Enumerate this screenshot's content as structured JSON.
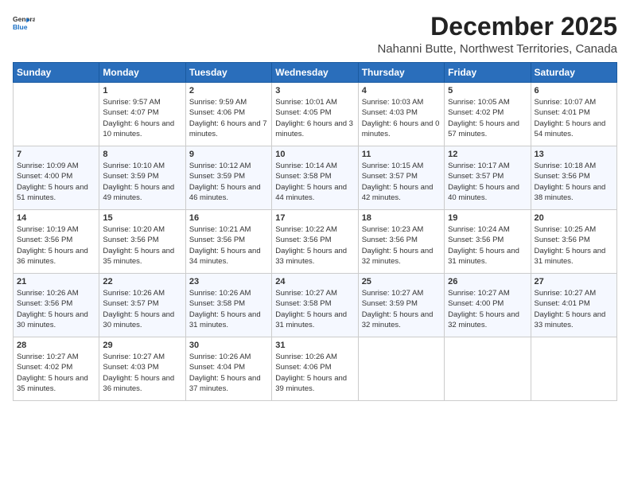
{
  "logo": {
    "line1": "General",
    "line2": "Blue"
  },
  "title": "December 2025",
  "subtitle": "Nahanni Butte, Northwest Territories, Canada",
  "weekdays": [
    "Sunday",
    "Monday",
    "Tuesday",
    "Wednesday",
    "Thursday",
    "Friday",
    "Saturday"
  ],
  "weeks": [
    [
      {
        "day": "",
        "sunrise": "",
        "sunset": "",
        "daylight": ""
      },
      {
        "day": "1",
        "sunrise": "Sunrise: 9:57 AM",
        "sunset": "Sunset: 4:07 PM",
        "daylight": "Daylight: 6 hours and 10 minutes."
      },
      {
        "day": "2",
        "sunrise": "Sunrise: 9:59 AM",
        "sunset": "Sunset: 4:06 PM",
        "daylight": "Daylight: 6 hours and 7 minutes."
      },
      {
        "day": "3",
        "sunrise": "Sunrise: 10:01 AM",
        "sunset": "Sunset: 4:05 PM",
        "daylight": "Daylight: 6 hours and 3 minutes."
      },
      {
        "day": "4",
        "sunrise": "Sunrise: 10:03 AM",
        "sunset": "Sunset: 4:03 PM",
        "daylight": "Daylight: 6 hours and 0 minutes."
      },
      {
        "day": "5",
        "sunrise": "Sunrise: 10:05 AM",
        "sunset": "Sunset: 4:02 PM",
        "daylight": "Daylight: 5 hours and 57 minutes."
      },
      {
        "day": "6",
        "sunrise": "Sunrise: 10:07 AM",
        "sunset": "Sunset: 4:01 PM",
        "daylight": "Daylight: 5 hours and 54 minutes."
      }
    ],
    [
      {
        "day": "7",
        "sunrise": "Sunrise: 10:09 AM",
        "sunset": "Sunset: 4:00 PM",
        "daylight": "Daylight: 5 hours and 51 minutes."
      },
      {
        "day": "8",
        "sunrise": "Sunrise: 10:10 AM",
        "sunset": "Sunset: 3:59 PM",
        "daylight": "Daylight: 5 hours and 49 minutes."
      },
      {
        "day": "9",
        "sunrise": "Sunrise: 10:12 AM",
        "sunset": "Sunset: 3:59 PM",
        "daylight": "Daylight: 5 hours and 46 minutes."
      },
      {
        "day": "10",
        "sunrise": "Sunrise: 10:14 AM",
        "sunset": "Sunset: 3:58 PM",
        "daylight": "Daylight: 5 hours and 44 minutes."
      },
      {
        "day": "11",
        "sunrise": "Sunrise: 10:15 AM",
        "sunset": "Sunset: 3:57 PM",
        "daylight": "Daylight: 5 hours and 42 minutes."
      },
      {
        "day": "12",
        "sunrise": "Sunrise: 10:17 AM",
        "sunset": "Sunset: 3:57 PM",
        "daylight": "Daylight: 5 hours and 40 minutes."
      },
      {
        "day": "13",
        "sunrise": "Sunrise: 10:18 AM",
        "sunset": "Sunset: 3:56 PM",
        "daylight": "Daylight: 5 hours and 38 minutes."
      }
    ],
    [
      {
        "day": "14",
        "sunrise": "Sunrise: 10:19 AM",
        "sunset": "Sunset: 3:56 PM",
        "daylight": "Daylight: 5 hours and 36 minutes."
      },
      {
        "day": "15",
        "sunrise": "Sunrise: 10:20 AM",
        "sunset": "Sunset: 3:56 PM",
        "daylight": "Daylight: 5 hours and 35 minutes."
      },
      {
        "day": "16",
        "sunrise": "Sunrise: 10:21 AM",
        "sunset": "Sunset: 3:56 PM",
        "daylight": "Daylight: 5 hours and 34 minutes."
      },
      {
        "day": "17",
        "sunrise": "Sunrise: 10:22 AM",
        "sunset": "Sunset: 3:56 PM",
        "daylight": "Daylight: 5 hours and 33 minutes."
      },
      {
        "day": "18",
        "sunrise": "Sunrise: 10:23 AM",
        "sunset": "Sunset: 3:56 PM",
        "daylight": "Daylight: 5 hours and 32 minutes."
      },
      {
        "day": "19",
        "sunrise": "Sunrise: 10:24 AM",
        "sunset": "Sunset: 3:56 PM",
        "daylight": "Daylight: 5 hours and 31 minutes."
      },
      {
        "day": "20",
        "sunrise": "Sunrise: 10:25 AM",
        "sunset": "Sunset: 3:56 PM",
        "daylight": "Daylight: 5 hours and 31 minutes."
      }
    ],
    [
      {
        "day": "21",
        "sunrise": "Sunrise: 10:26 AM",
        "sunset": "Sunset: 3:56 PM",
        "daylight": "Daylight: 5 hours and 30 minutes."
      },
      {
        "day": "22",
        "sunrise": "Sunrise: 10:26 AM",
        "sunset": "Sunset: 3:57 PM",
        "daylight": "Daylight: 5 hours and 30 minutes."
      },
      {
        "day": "23",
        "sunrise": "Sunrise: 10:26 AM",
        "sunset": "Sunset: 3:58 PM",
        "daylight": "Daylight: 5 hours and 31 minutes."
      },
      {
        "day": "24",
        "sunrise": "Sunrise: 10:27 AM",
        "sunset": "Sunset: 3:58 PM",
        "daylight": "Daylight: 5 hours and 31 minutes."
      },
      {
        "day": "25",
        "sunrise": "Sunrise: 10:27 AM",
        "sunset": "Sunset: 3:59 PM",
        "daylight": "Daylight: 5 hours and 32 minutes."
      },
      {
        "day": "26",
        "sunrise": "Sunrise: 10:27 AM",
        "sunset": "Sunset: 4:00 PM",
        "daylight": "Daylight: 5 hours and 32 minutes."
      },
      {
        "day": "27",
        "sunrise": "Sunrise: 10:27 AM",
        "sunset": "Sunset: 4:01 PM",
        "daylight": "Daylight: 5 hours and 33 minutes."
      }
    ],
    [
      {
        "day": "28",
        "sunrise": "Sunrise: 10:27 AM",
        "sunset": "Sunset: 4:02 PM",
        "daylight": "Daylight: 5 hours and 35 minutes."
      },
      {
        "day": "29",
        "sunrise": "Sunrise: 10:27 AM",
        "sunset": "Sunset: 4:03 PM",
        "daylight": "Daylight: 5 hours and 36 minutes."
      },
      {
        "day": "30",
        "sunrise": "Sunrise: 10:26 AM",
        "sunset": "Sunset: 4:04 PM",
        "daylight": "Daylight: 5 hours and 37 minutes."
      },
      {
        "day": "31",
        "sunrise": "Sunrise: 10:26 AM",
        "sunset": "Sunset: 4:06 PM",
        "daylight": "Daylight: 5 hours and 39 minutes."
      },
      {
        "day": "",
        "sunrise": "",
        "sunset": "",
        "daylight": ""
      },
      {
        "day": "",
        "sunrise": "",
        "sunset": "",
        "daylight": ""
      },
      {
        "day": "",
        "sunrise": "",
        "sunset": "",
        "daylight": ""
      }
    ]
  ]
}
